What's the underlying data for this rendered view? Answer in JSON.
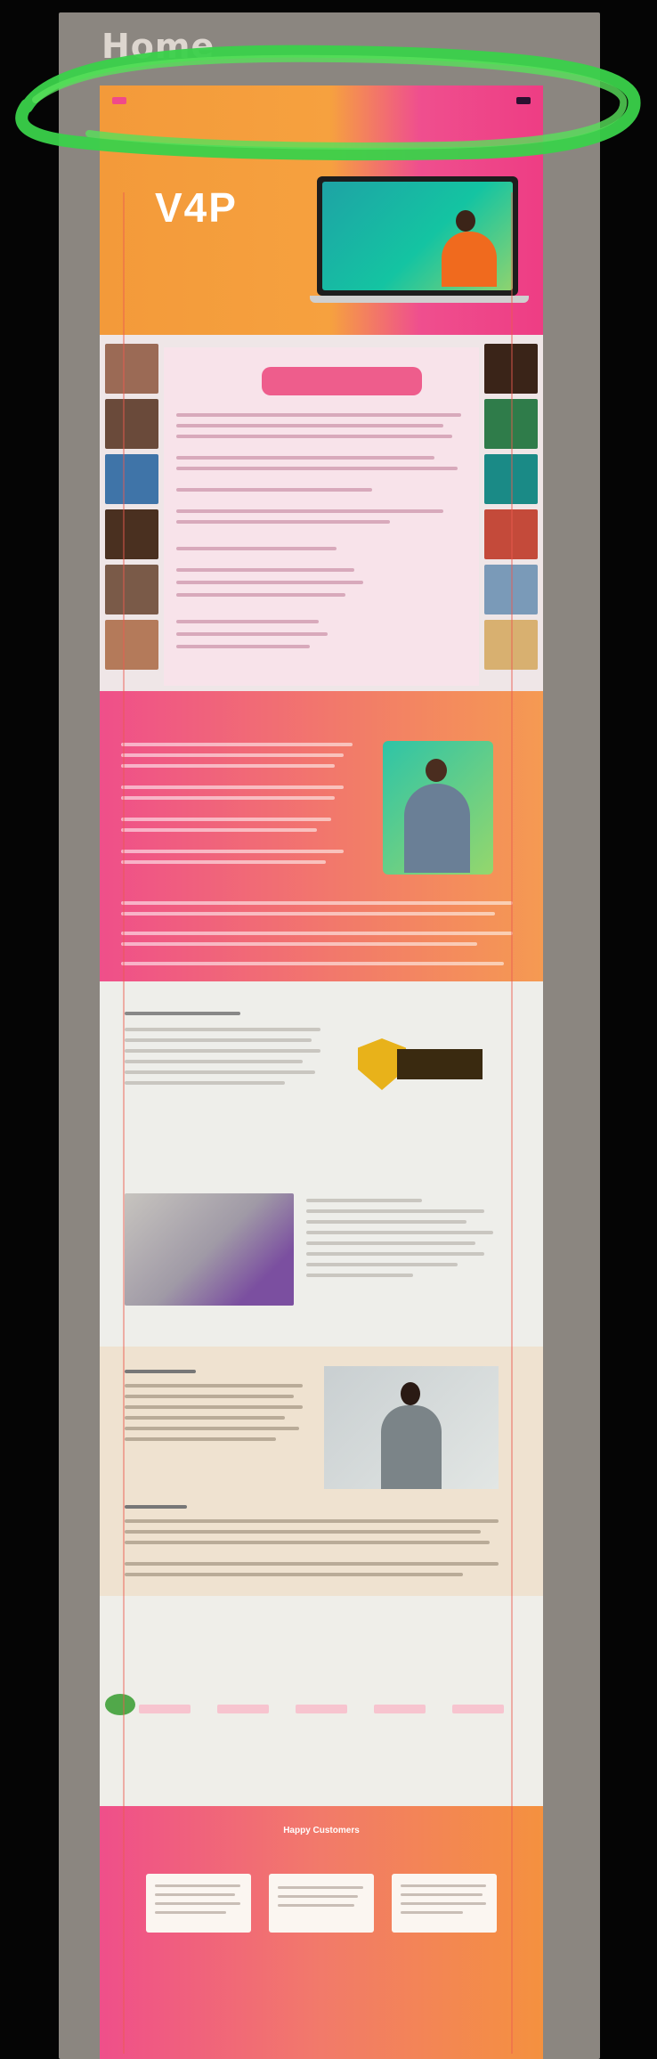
{
  "screen": {
    "title": "Home"
  },
  "brand": {
    "logo": "",
    "hero_title": "V4P",
    "hero_tagline": ""
  },
  "nav": {
    "links": [
      "",
      "",
      "",
      "",
      "",
      ""
    ],
    "cta": ""
  },
  "laptop": {
    "headline": ""
  },
  "collage": {
    "title": ""
  },
  "pink_section": {
    "heading": ""
  },
  "badge": {
    "lines": [
      "",
      "",
      ""
    ]
  },
  "light_section": {
    "heading": "",
    "subheading": ""
  },
  "beige_section": {
    "heading_1": "",
    "heading_2": ""
  },
  "pricing": {
    "heading": "",
    "subheading": "",
    "plans": [
      {
        "name": "",
        "price": "",
        "old_price": "",
        "button": ""
      },
      {
        "name": "",
        "price": "",
        "old_price": "",
        "button": ""
      },
      {
        "name": "",
        "price": "",
        "old_price": "",
        "button": ""
      },
      {
        "name": "",
        "price": "",
        "old_price": "",
        "button": ""
      },
      {
        "name": "",
        "price": "",
        "old_price": "",
        "button": ""
      }
    ]
  },
  "footer": {
    "heading": "Happy Customers",
    "subheading": ""
  },
  "colors": {
    "orange": "#f39a3a",
    "pink": "#ee3d84",
    "annotation_green": "#3ad14a"
  }
}
